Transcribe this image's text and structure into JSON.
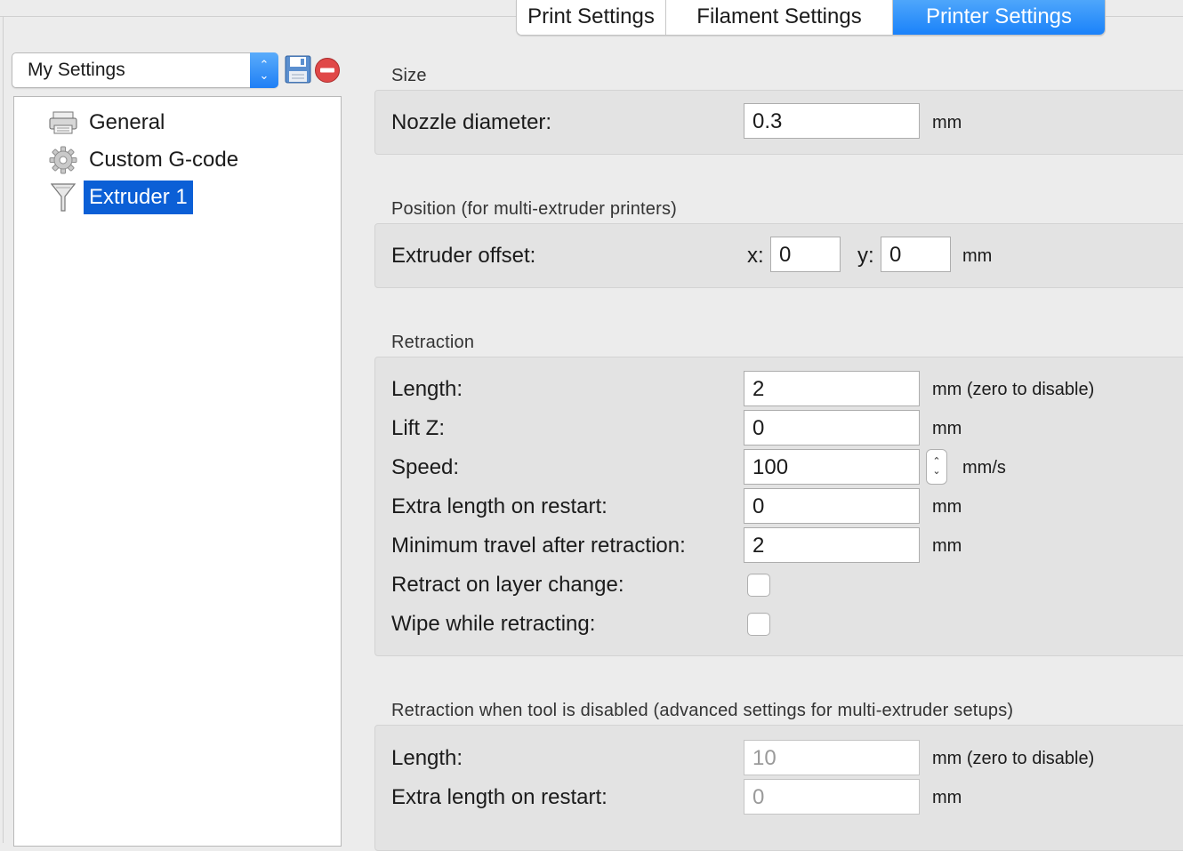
{
  "tabs": [
    {
      "label": "Print Settings",
      "active": false
    },
    {
      "label": "Filament Settings",
      "active": false
    },
    {
      "label": "Printer Settings",
      "active": true
    }
  ],
  "preset": {
    "selected": "My Settings"
  },
  "tree": [
    {
      "label": "General",
      "icon": "printer-icon",
      "selected": false
    },
    {
      "label": "Custom G-code",
      "icon": "gear-icon",
      "selected": false
    },
    {
      "label": "Extruder 1",
      "icon": "funnel-icon",
      "selected": true
    }
  ],
  "size": {
    "title": "Size",
    "nozzle_label": "Nozzle diameter:",
    "nozzle_value": "0.3",
    "nozzle_unit": "mm"
  },
  "position": {
    "title": "Position (for multi-extruder printers)",
    "offset_label": "Extruder offset:",
    "x_label": "x:",
    "x_value": "0",
    "y_label": "y:",
    "y_value": "0",
    "unit": "mm"
  },
  "retraction": {
    "title": "Retraction",
    "length_label": "Length:",
    "length_value": "2",
    "length_unit": "mm (zero to disable)",
    "liftz_label": "Lift Z:",
    "liftz_value": "0",
    "liftz_unit": "mm",
    "speed_label": "Speed:",
    "speed_value": "100",
    "speed_unit": "mm/s",
    "extra_label": "Extra length on restart:",
    "extra_value": "0",
    "extra_unit": "mm",
    "mintravel_label": "Minimum travel after retraction:",
    "mintravel_value": "2",
    "mintravel_unit": "mm",
    "layerchange_label": "Retract on layer change:",
    "layerchange_checked": false,
    "wipe_label": "Wipe while retracting:",
    "wipe_checked": false
  },
  "tool_disabled": {
    "title": "Retraction when tool is disabled (advanced settings for multi-extruder setups)",
    "length_label": "Length:",
    "length_value": "10",
    "length_unit": "mm (zero to disable)",
    "extra_label": "Extra length on restart:",
    "extra_value": "0",
    "extra_unit": "mm"
  },
  "colors": {
    "accent": "#1a82fa",
    "selection": "#0b5fd6",
    "panel": "#e3e3e3"
  }
}
